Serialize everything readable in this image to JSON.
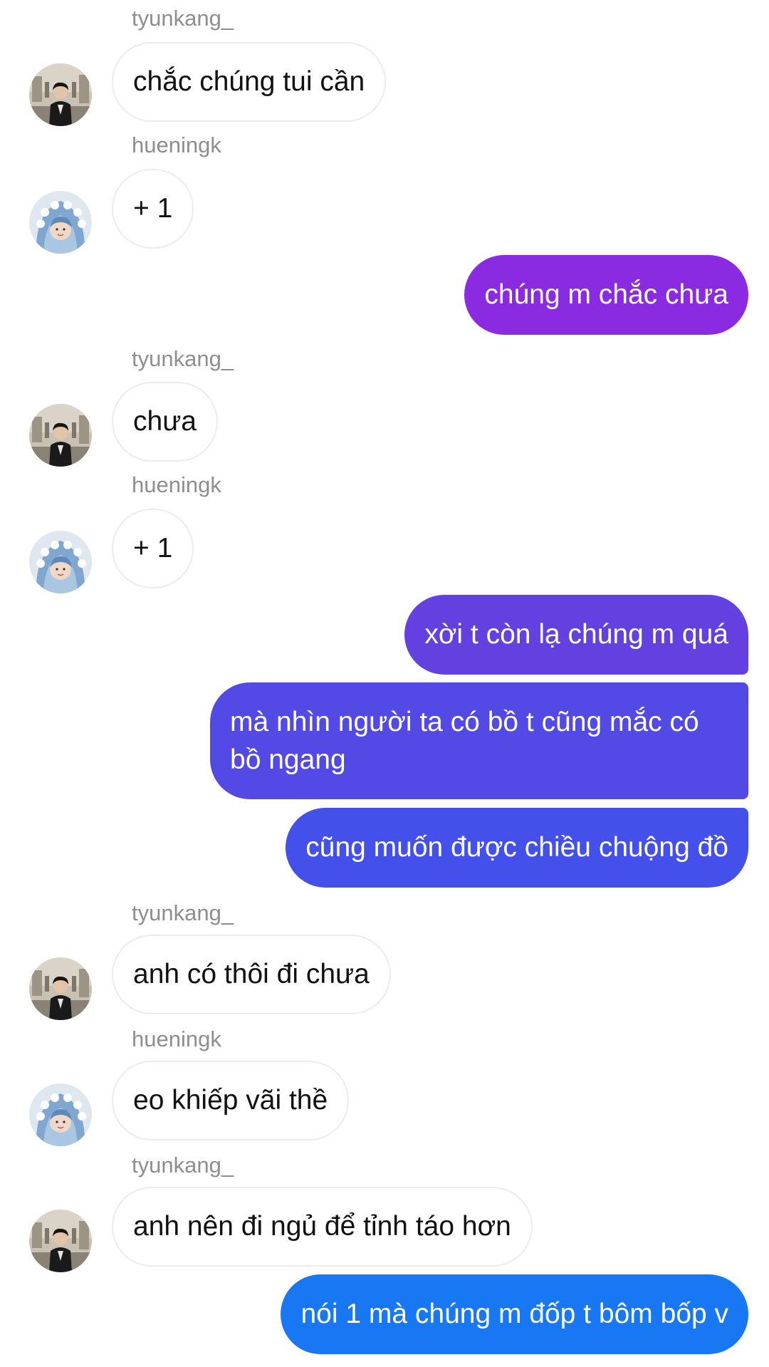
{
  "thread": {
    "users": {
      "tyunkang": "tyunkang_",
      "hueningk": "hueningk"
    },
    "messages": [
      {
        "sender": "tyunkang_",
        "text": "chắc chúng tui cần"
      },
      {
        "sender": "hueningk",
        "text": "+ 1"
      },
      {
        "sender": "me",
        "text": "chúng m chắc chưa"
      },
      {
        "sender": "tyunkang_",
        "text": "chưa"
      },
      {
        "sender": "hueningk",
        "text": "+ 1"
      },
      {
        "sender": "me",
        "text": "xời t còn lạ chúng m quá"
      },
      {
        "sender": "me",
        "text": "mà nhìn người ta có bồ t cũng mắc có bồ ngang"
      },
      {
        "sender": "me",
        "text": "cũng muốn được chiều chuộng đồ"
      },
      {
        "sender": "tyunkang_",
        "text": "anh có thôi đi chưa"
      },
      {
        "sender": "hueningk",
        "text": "eo khiếp vãi thề"
      },
      {
        "sender": "tyunkang_",
        "text": "anh nên đi ngủ để tỉnh táo hơn"
      },
      {
        "sender": "me",
        "text": "nói 1 mà chúng m đốp t bôm bốp v"
      }
    ]
  },
  "colors": {
    "outgoing_gradient_top": "#8a2be2",
    "outgoing_gradient_bottom": "#1877f2",
    "incoming_border": "#ececec",
    "sender_name": "#8e8e8e"
  },
  "icons": {
    "avatar_tyunkang": "avatar-tyunkang-icon",
    "avatar_hueningk": "avatar-hueningk-icon"
  }
}
